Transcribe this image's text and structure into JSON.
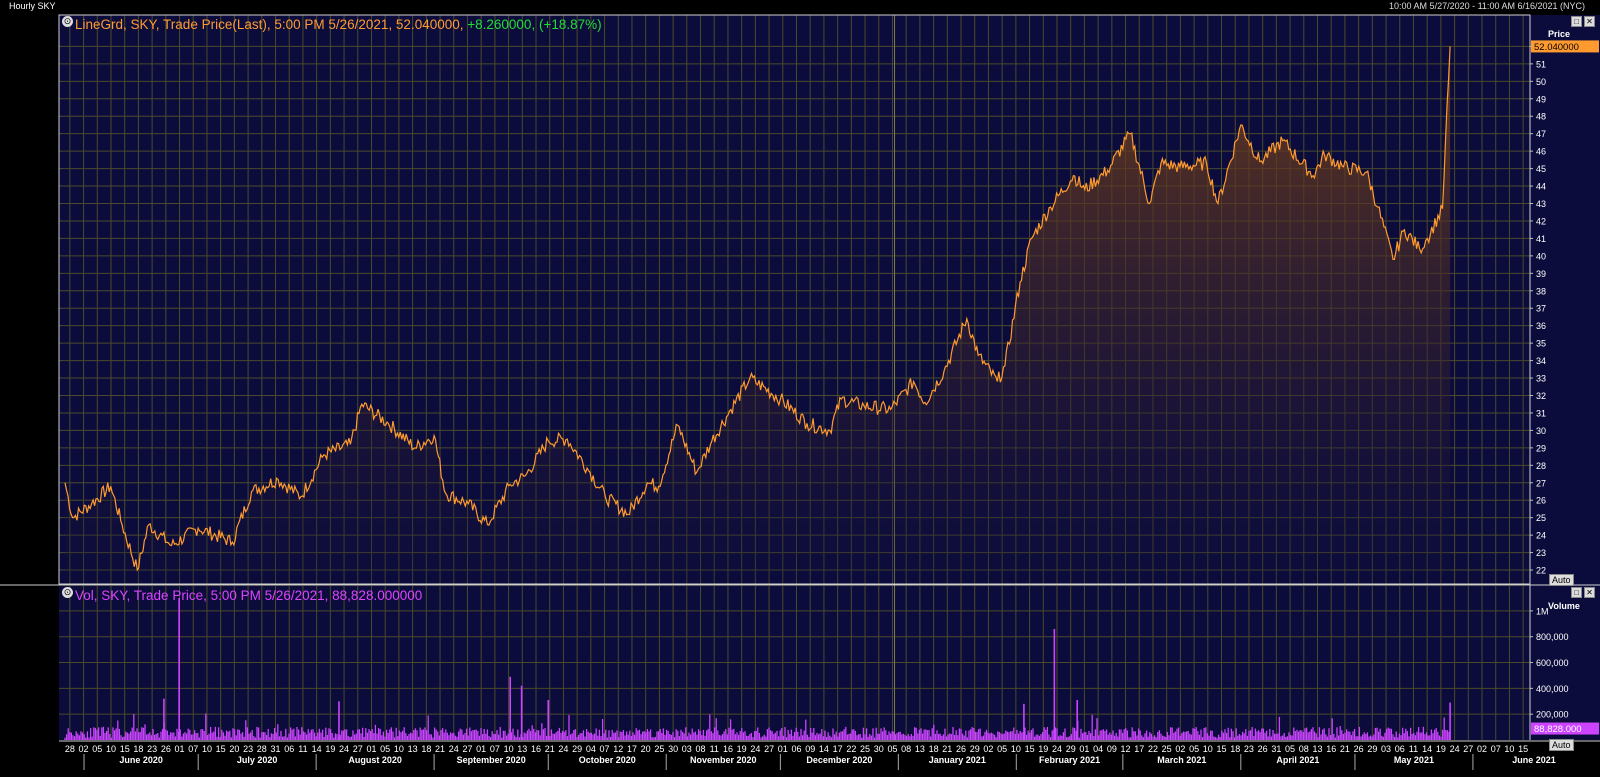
{
  "header": {
    "title": "Hourly SKY",
    "range": "10:00 AM 5/27/2020 - 11:00 AM 6/16/2021 (NYC)"
  },
  "price_panel": {
    "legend_prefix": "LineGrd, SKY, Trade Price(Last), 5:00 PM 5/26/2021, 52.040000, ",
    "legend_change": "+8.260000, (+18.87%)",
    "axis_title": "Price",
    "last_label": "52.040000",
    "auto_label": "Auto",
    "line_color": "#ff9b2e"
  },
  "volume_panel": {
    "legend": "Vol, SKY, Trade Price, 5:00 PM 5/26/2021, 88,828.000000",
    "axis_title": "Volume",
    "last_label": "88,828.000",
    "auto_label": "Auto",
    "bar_color": "#cc44ff"
  },
  "chart_data": [
    {
      "type": "area",
      "title": "LineGrd, SKY, Trade Price(Last)",
      "ylabel": "Price",
      "ylim": [
        21.2,
        53.8
      ],
      "yticks": [
        22,
        23,
        24,
        25,
        26,
        27,
        28,
        29,
        30,
        31,
        32,
        33,
        34,
        35,
        36,
        37,
        38,
        39,
        40,
        41,
        42,
        43,
        44,
        45,
        46,
        47,
        48,
        49,
        50,
        51,
        52
      ],
      "x_day_labels": [
        "28",
        "02",
        "05",
        "10",
        "15",
        "18",
        "23",
        "26",
        "01",
        "07",
        "10",
        "15",
        "20",
        "23",
        "28",
        "31",
        "06",
        "11",
        "14",
        "19",
        "24",
        "27",
        "01",
        "05",
        "10",
        "13",
        "18",
        "21",
        "24",
        "27",
        "01",
        "07",
        "10",
        "13",
        "16",
        "21",
        "24",
        "29",
        "04",
        "07",
        "12",
        "17",
        "20",
        "25",
        "30",
        "03",
        "08",
        "11",
        "16",
        "19",
        "24",
        "27",
        "01",
        "06",
        "09",
        "14",
        "17",
        "22",
        "25",
        "30",
        "05",
        "08",
        "13",
        "18",
        "21",
        "26",
        "29",
        "02",
        "05",
        "10",
        "15",
        "19",
        "24",
        "29",
        "01",
        "04",
        "09",
        "12",
        "17",
        "22",
        "25",
        "02",
        "05",
        "10",
        "15",
        "18",
        "23",
        "26",
        "31",
        "05",
        "08",
        "13",
        "16",
        "21",
        "26",
        "29",
        "03",
        "06",
        "11",
        "14",
        "19",
        "24",
        "27",
        "02",
        "07",
        "10",
        "15"
      ],
      "x_month_labels": [
        "June 2020",
        "July 2020",
        "August 2020",
        "September 2020",
        "October 2020",
        "November 2020",
        "December 2020",
        "January 2021",
        "February 2021",
        "March 2021",
        "April 2021",
        "May 2021",
        "June 2021"
      ],
      "x": [
        "2020-05-27",
        "2020-05-29",
        "2020-06-03",
        "2020-06-08",
        "2020-06-11",
        "2020-06-15",
        "2020-06-18",
        "2020-06-24",
        "2020-07-01",
        "2020-07-10",
        "2020-07-15",
        "2020-07-22",
        "2020-07-28",
        "2020-08-03",
        "2020-08-10",
        "2020-08-13",
        "2020-08-20",
        "2020-08-27",
        "2020-09-01",
        "2020-09-04",
        "2020-09-10",
        "2020-09-15",
        "2020-09-21",
        "2020-09-25",
        "2020-10-01",
        "2020-10-06",
        "2020-10-12",
        "2020-10-16",
        "2020-10-22",
        "2020-10-27",
        "2020-10-30",
        "2020-11-04",
        "2020-11-09",
        "2020-11-13",
        "2020-11-18",
        "2020-11-23",
        "2020-12-01",
        "2020-12-08",
        "2020-12-14",
        "2020-12-17",
        "2020-12-23",
        "2020-12-30",
        "2021-01-05",
        "2021-01-08",
        "2021-01-13",
        "2021-01-19",
        "2021-01-22",
        "2021-01-27",
        "2021-01-29",
        "2021-02-02",
        "2021-02-05",
        "2021-02-10",
        "2021-02-16",
        "2021-02-19",
        "2021-02-25",
        "2021-03-03",
        "2021-03-08",
        "2021-03-11",
        "2021-03-16",
        "2021-03-23",
        "2021-03-26",
        "2021-04-01",
        "2021-04-06",
        "2021-04-12",
        "2021-04-20",
        "2021-04-23",
        "2021-04-28",
        "2021-05-04",
        "2021-05-07",
        "2021-05-11",
        "2021-05-14",
        "2021-05-18",
        "2021-05-20",
        "2021-05-24",
        "2021-05-26"
      ],
      "series": [
        {
          "values": [
            27.0,
            25.0,
            25.8,
            26.8,
            24.6,
            22.0,
            24.6,
            23.4,
            24.4,
            23.6,
            26.5,
            27.2,
            26.2,
            28.6,
            29.2,
            31.5,
            30.4,
            29.0,
            29.7,
            26.4,
            25.8,
            24.6,
            26.9,
            27.4,
            29.4,
            29.5,
            27.6,
            26.2,
            25.2,
            27.0,
            26.8,
            30.3,
            27.6,
            29.4,
            31.2,
            33.0,
            31.8,
            30.4,
            30.0,
            31.8,
            31.4,
            31.2,
            32.8,
            31.6,
            33.4,
            36.4,
            34.3,
            32.8,
            33.7,
            38.5,
            41.0,
            42.8,
            44.6,
            43.8,
            44.9,
            47.0,
            43.0,
            45.3,
            45.1,
            45.3,
            43.0,
            47.5,
            45.4,
            46.6,
            44.6,
            45.8,
            45.1,
            44.8,
            42.8,
            39.8,
            41.5,
            40.4,
            41.0,
            42.7,
            52.0
          ]
        }
      ]
    },
    {
      "type": "bar",
      "title": "Vol, SKY, Trade Price",
      "ylabel": "Volume",
      "ylim": [
        0,
        1100000
      ],
      "yticks": [
        "200,000",
        "400,000",
        "600,000",
        "800,000",
        "1M"
      ],
      "typical_volume": 60000,
      "spikes": [
        {
          "x": "2020-06-26",
          "value": 1100000
        },
        {
          "x": "2020-06-22",
          "value": 320000
        },
        {
          "x": "2020-08-07",
          "value": 300000
        },
        {
          "x": "2020-09-21",
          "value": 490000
        },
        {
          "x": "2020-09-24",
          "value": 420000
        },
        {
          "x": "2020-10-01",
          "value": 310000
        },
        {
          "x": "2021-02-11",
          "value": 860000
        },
        {
          "x": "2021-02-03",
          "value": 280000
        },
        {
          "x": "2021-02-17",
          "value": 310000
        },
        {
          "x": "2021-05-26",
          "value": 290000
        }
      ]
    }
  ]
}
